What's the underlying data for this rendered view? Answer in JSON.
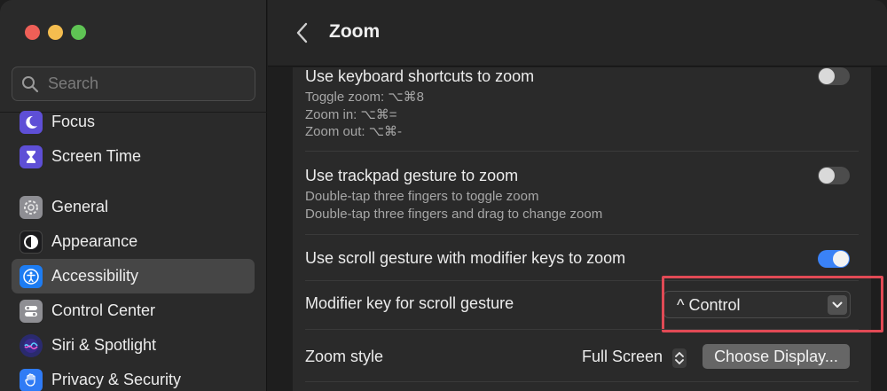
{
  "window": {
    "title": "Zoom"
  },
  "sidebar": {
    "search_placeholder": "Search",
    "items": [
      {
        "label": "Focus",
        "icon": "moon-icon",
        "color": "#5e4fd6"
      },
      {
        "label": "Screen Time",
        "icon": "hourglass-icon",
        "color": "#5e4fd6"
      },
      {
        "label": "General",
        "icon": "gear-icon",
        "color": "#8e8e93"
      },
      {
        "label": "Appearance",
        "icon": "appearance-icon",
        "color": "#1c1c1e"
      },
      {
        "label": "Accessibility",
        "icon": "accessibility-icon",
        "color": "#1d7cf2",
        "selected": true
      },
      {
        "label": "Control Center",
        "icon": "control-center-icon",
        "color": "#8e8e93"
      },
      {
        "label": "Siri & Spotlight",
        "icon": "siri-icon",
        "color": "#2a2a6e"
      },
      {
        "label": "Privacy & Security",
        "icon": "hand-icon",
        "color": "#2f7bf5"
      }
    ]
  },
  "settings": {
    "keyboard": {
      "title": "Use keyboard shortcuts to zoom",
      "lines": [
        "Toggle zoom: ⌥⌘8",
        "Zoom in: ⌥⌘=",
        "Zoom out: ⌥⌘-"
      ],
      "on": false
    },
    "trackpad": {
      "title": "Use trackpad gesture to zoom",
      "lines": [
        "Double-tap three fingers to toggle zoom",
        "Double-tap three fingers and drag to change zoom"
      ],
      "on": false
    },
    "scroll": {
      "title": "Use scroll gesture with modifier keys to zoom",
      "on": true
    },
    "modifier": {
      "title": "Modifier key for scroll gesture",
      "value": "^ Control"
    },
    "zoom_style": {
      "title": "Zoom style",
      "value": "Full Screen",
      "button": "Choose Display..."
    }
  },
  "colors": {
    "accent": "#3a82f7",
    "highlight": "#e14a55"
  }
}
